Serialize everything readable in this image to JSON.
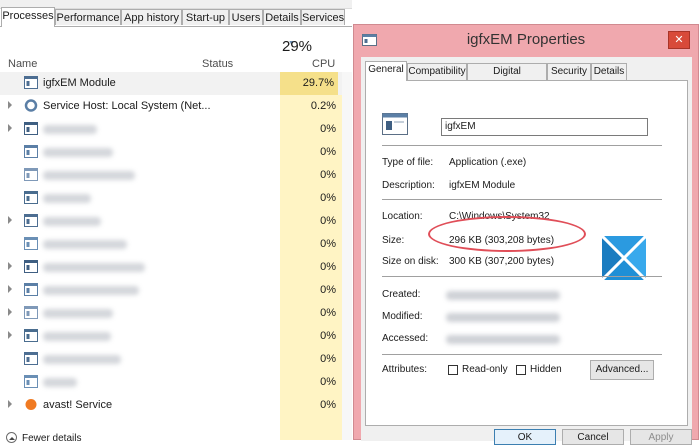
{
  "task_manager": {
    "tabs": [
      "Processes",
      "Performance",
      "App history",
      "Start-up",
      "Users",
      "Details",
      "Services"
    ],
    "cpu_total": "29%",
    "columns": {
      "name": "Name",
      "status": "Status",
      "cpu": "CPU"
    },
    "rows": [
      {
        "name": "igfxEM Module",
        "cpu": "29.7%",
        "expand": false
      },
      {
        "name": "Service Host: Local System (Net...",
        "cpu": "0.2%",
        "expand": true
      },
      {
        "name": "",
        "cpu": "0%",
        "expand": true
      },
      {
        "name": "",
        "cpu": "0%",
        "expand": false
      },
      {
        "name": "",
        "cpu": "0%",
        "expand": false
      },
      {
        "name": "",
        "cpu": "0%",
        "expand": false
      },
      {
        "name": "",
        "cpu": "0%",
        "expand": true
      },
      {
        "name": "",
        "cpu": "0%",
        "expand": false
      },
      {
        "name": "",
        "cpu": "0%",
        "expand": true
      },
      {
        "name": "",
        "cpu": "0%",
        "expand": true
      },
      {
        "name": "",
        "cpu": "0%",
        "expand": true
      },
      {
        "name": "",
        "cpu": "0%",
        "expand": true
      },
      {
        "name": "",
        "cpu": "0%",
        "expand": false
      },
      {
        "name": "",
        "cpu": "0%",
        "expand": false
      },
      {
        "name": "avast! Service",
        "cpu": "0%",
        "expand": true
      }
    ],
    "fewer_details": "Fewer details"
  },
  "dialog": {
    "title": "igfxEM Properties",
    "close_label": "✕",
    "tabs": [
      "General",
      "Compatibility",
      "Digital Signatures",
      "Security",
      "Details"
    ],
    "file_name": "igfxEM",
    "type_label": "Type of file:",
    "type_value": "Application (.exe)",
    "desc_label": "Description:",
    "desc_value": "igfxEM Module",
    "location_label": "Location:",
    "location_value": "C:\\Windows\\System32",
    "size_label": "Size:",
    "size_value": "296 KB (303,208 bytes)",
    "size_on_disk_label": "Size on disk:",
    "size_on_disk_value": "300 KB (307,200 bytes)",
    "created_label": "Created:",
    "modified_label": "Modified:",
    "accessed_label": "Accessed:",
    "attributes_label": "Attributes:",
    "readonly_label": "Read-only",
    "hidden_label": "Hidden",
    "advanced_label": "Advanced...",
    "ok_label": "OK",
    "cancel_label": "Cancel",
    "apply_label": "Apply"
  },
  "colors": {
    "cpu_highlight": "#fff4c4",
    "dialog_frame": "#f0a8ae",
    "annotation_ellipse": "#e04e58"
  }
}
